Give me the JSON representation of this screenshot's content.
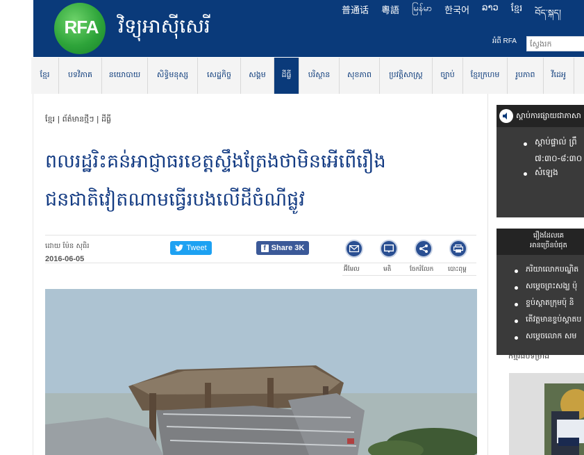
{
  "header": {
    "logo_text": "RFA",
    "site_name": "វិទ្យុអាស៊ីសេរី",
    "languages": [
      "普通话",
      "粵語",
      "မြန်မာ",
      "한국어",
      "ລາວ",
      "ខ្មែរ",
      "བོད་སྐད།"
    ],
    "rfa_label": "អំពី RFA",
    "search_placeholder": "ស្វែងរក"
  },
  "nav": {
    "items": [
      {
        "label": "ខ្មែរ",
        "width": 40
      },
      {
        "label": "បទវិភាគ",
        "width": 62
      },
      {
        "label": "នយោបាយ",
        "width": 66
      },
      {
        "label": "សិទ្ធិមនុស្ស",
        "width": 72
      },
      {
        "label": "សេដ្ឋកិច្ច",
        "width": 62
      },
      {
        "label": "សង្គម",
        "width": 48
      },
      {
        "label": "ដីធ្លី",
        "width": 36
      },
      {
        "label": "បរិស្ថាន",
        "width": 58
      },
      {
        "label": "សុខភាព",
        "width": 58
      },
      {
        "label": "ប្រវត្តិសាស្ត្រ",
        "width": 76
      },
      {
        "label": "ច្បាប់",
        "width": 44
      },
      {
        "label": "ខ្មែរក្រហម",
        "width": 64
      },
      {
        "label": "រូបភាព",
        "width": 52
      },
      {
        "label": "វីដេអូ",
        "width": 44
      },
      {
        "label": "",
        "width": 18
      }
    ],
    "active_index": 6
  },
  "article": {
    "breadcrumb": "ខ្មែរ | ព័ត៌មានថ្មីៗ | ដីធ្លី",
    "headline_line1": "ពលរដ្ឋរិះគន់អាជ្ញាធរខេត្តស្ទឹងត្រែងថាមិនអើពើរឿង",
    "headline_line2": "ជនជាតិវៀតណាមធ្វើរបងលើដីចំណីផ្លូវ",
    "author": "ដោយ ម៉ែន សុធិរ",
    "date": "2016-06-05",
    "tweet_label": "Tweet",
    "share_label": "Share 3K",
    "tools": [
      {
        "label": "អ៊ីមែល",
        "icon": "email-icon"
      },
      {
        "label": "មតិ",
        "icon": "comment-icon"
      },
      {
        "label": "ចែករំលែក",
        "icon": "share-icon"
      },
      {
        "label": "បោះពុម្ព",
        "icon": "print-icon"
      }
    ]
  },
  "sidebar": {
    "listen_title": "ស្ដាប់ការផ្សាយជាភាសា",
    "listen_items": [
      "ស្ដាប់ផ្ទាល់ ព្រឹ",
      "៧:៣០-៨:៣០",
      "សំឡេង"
    ],
    "popular_title_line1": "រឿងដែលគេ",
    "popular_title_line2": "អានច្រើនបំផុត",
    "popular_items": [
      "ភរិយាលោកបណ្ឌិត",
      "សម្ដេចព្រះសង្ឃ ប៉ុ",
      "ខ្ទប់ស្ដាតក្រុមប៉ុ និ",
      "តើវត្តមានខ្ទប់ស្ដាតប",
      "សម្ដេចលោក សម"
    ],
    "section_label": "កម្មវិធីបទម្រាំង"
  },
  "colors": {
    "header_blue": "#0a3a7a",
    "headline_blue": "#123a82",
    "tweet_blue": "#1da1f2",
    "facebook_blue": "#3b5998",
    "sidebar_dark": "#3a3a3a"
  }
}
